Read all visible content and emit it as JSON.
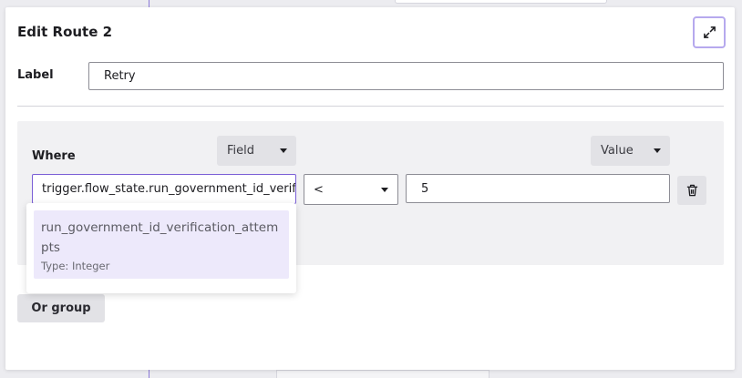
{
  "modal": {
    "title": "Edit Route 2"
  },
  "label_row": {
    "label": "Label",
    "value": "Retry"
  },
  "where": {
    "heading": "Where",
    "field_chip": "Field",
    "value_chip": "Value",
    "field_input_value": "trigger.flow_state.run_government_id_verification_attempts",
    "operator": "<",
    "value": "5"
  },
  "suggestion": {
    "name": "run_government_id_verification_attempts",
    "type": "Type: Integer"
  },
  "or_group_label": "Or group",
  "colors": {
    "accent": "#7a5fd6",
    "accent_light": "#ede9fb",
    "panel": "#f1f1f3"
  }
}
